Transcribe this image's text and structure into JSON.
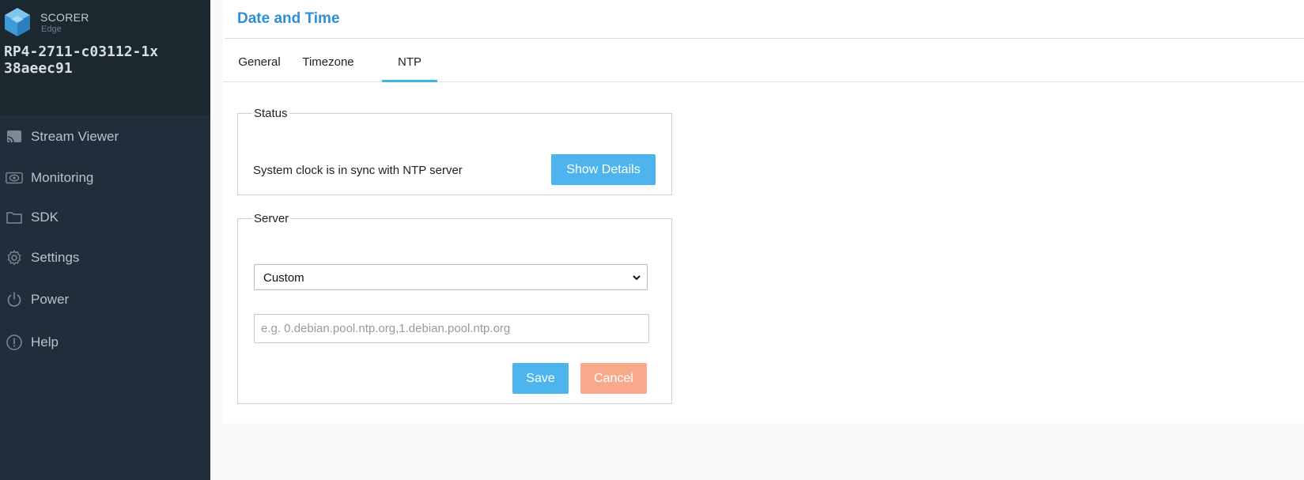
{
  "sidebar": {
    "brand_name": "SCORER",
    "brand_sub": "Edge",
    "device_line1": "RP4-2711-c03112-1x",
    "device_line2": "38aeec91",
    "items": [
      {
        "label": "Stream Viewer",
        "icon": "cast-icon"
      },
      {
        "label": "Monitoring",
        "icon": "eye-icon"
      },
      {
        "label": "SDK",
        "icon": "folder-icon"
      },
      {
        "label": "Settings",
        "icon": "gear-icon"
      },
      {
        "label": "Power",
        "icon": "power-icon"
      },
      {
        "label": "Help",
        "icon": "info-icon"
      }
    ]
  },
  "page": {
    "title": "Date and Time",
    "tabs": [
      {
        "label": "General"
      },
      {
        "label": "Timezone"
      },
      {
        "label": "NTP",
        "active": true
      }
    ]
  },
  "status": {
    "legend": "Status",
    "message": "System clock is in sync with NTP server",
    "details_button": "Show Details"
  },
  "server": {
    "legend": "Server",
    "selected": "Custom",
    "input_value": "",
    "input_placeholder": "e.g. 0.debian.pool.ntp.org,1.debian.pool.ntp.org",
    "save_label": "Save",
    "cancel_label": "Cancel"
  },
  "colors": {
    "sidebar_bg": "#1f2e3a",
    "accent": "#2d8fd5",
    "primary_button": "#4eb4ee",
    "cancel_button": "#f9a98b",
    "tab_indicator": "#3fb6e3"
  }
}
